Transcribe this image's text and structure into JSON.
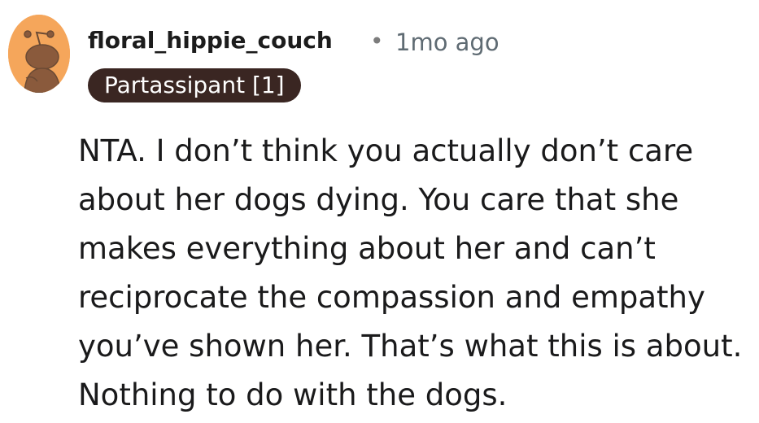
{
  "comment": {
    "author": "floral_hippie_couch",
    "separator": "•",
    "timestamp": "1mo ago",
    "flair": "Partassipant [1]",
    "body_lines": [
      "NTA. I don’t think you actually don’t care",
      "about her dogs dying. You care that she",
      "makes everything about her and can’t",
      "reciprocate the compassion and empathy",
      "you’ve shown her. That’s what this is about.",
      "Nothing to do with the dogs."
    ]
  },
  "colors": {
    "avatar_background": "#f5a65b",
    "avatar_figure": "#8a5a3c",
    "flair_background": "#3a2622",
    "flair_text": "#ffffff",
    "timestamp": "#5f6b73"
  },
  "icons": {
    "avatar": "snoo-avatar-icon"
  }
}
